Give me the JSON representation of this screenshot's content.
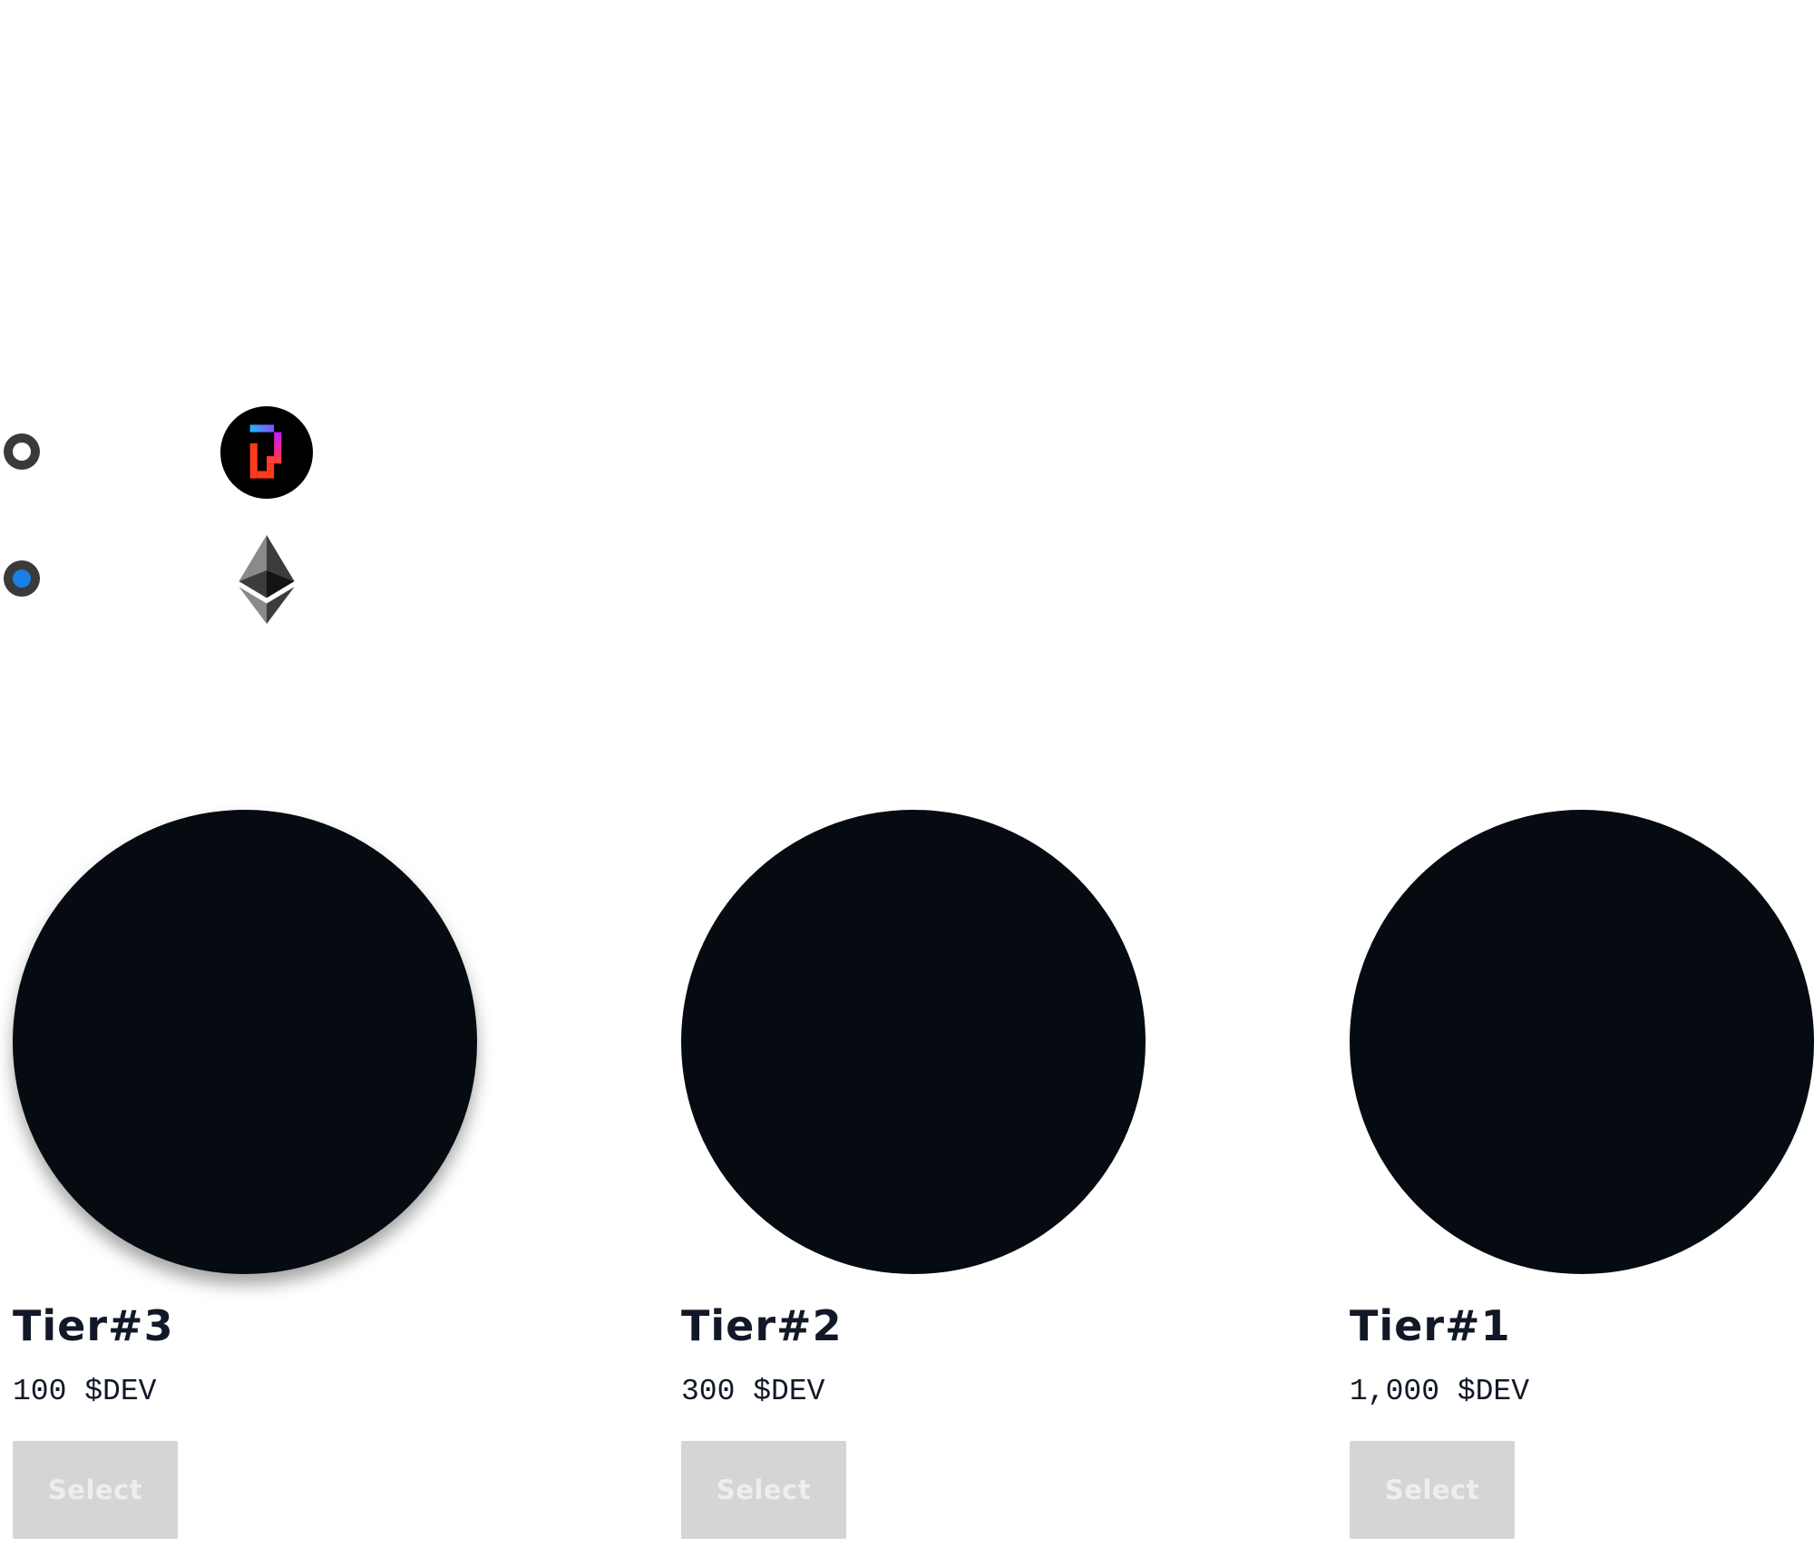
{
  "currency_options": [
    {
      "id": "dev",
      "icon": "dev-token-logo",
      "selected": false
    },
    {
      "id": "eth",
      "icon": "ethereum-logo",
      "selected": true
    }
  ],
  "colors": {
    "radio_selected": "#1a7fe6",
    "radio_ring": "#3a3a3a",
    "tier_image": "#050b10",
    "button_disabled_bg": "#d5d5d5",
    "button_disabled_text": "#eeeeee",
    "text": "#111827"
  },
  "tiers": [
    {
      "name": "Tier#3",
      "price": "100 $DEV",
      "button_label": "Select"
    },
    {
      "name": "Tier#2",
      "price": "300 $DEV",
      "button_label": "Select"
    },
    {
      "name": "Tier#1",
      "price": "1,000 $DEV",
      "button_label": "Select"
    }
  ]
}
